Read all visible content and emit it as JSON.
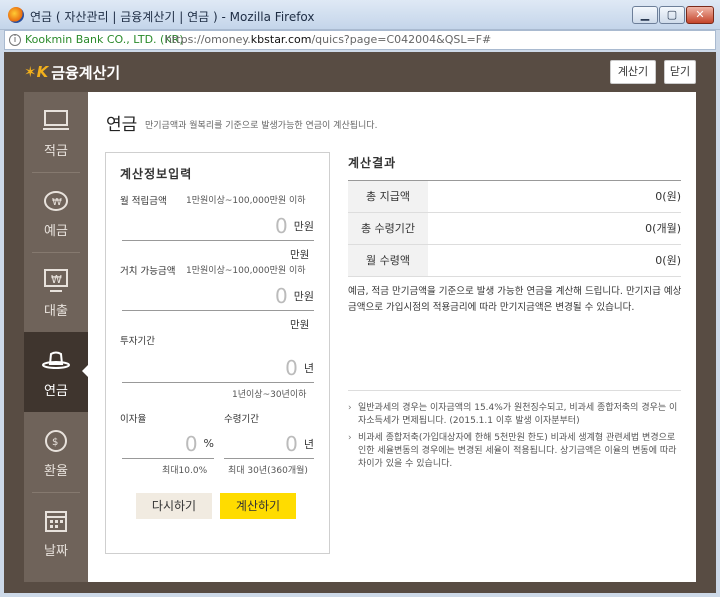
{
  "window": {
    "title": "연금 ( 자산관리 | 금융계산기 | 연금 ) - Mozilla Firefox",
    "minimize_icon": "▁",
    "maximize_icon": "▢",
    "close_icon": "✕"
  },
  "urlbar": {
    "info_icon": "i",
    "org": "Kookmin Bank CO., LTD. (KR)",
    "url_prefix": "https://omoney.",
    "url_domain": "kbstar.com",
    "url_suffix": "/quics?page=C042004&QSL=F#"
  },
  "app": {
    "logo_mark": "✶K",
    "logo_name": "금융계산기",
    "calc_button": "계산기",
    "close_button": "닫기"
  },
  "sidebar": {
    "items": [
      {
        "label": "적금",
        "icon": "savings-icon",
        "active": false
      },
      {
        "label": "예금",
        "icon": "piggybank-icon",
        "active": false
      },
      {
        "label": "대출",
        "icon": "loan-icon",
        "active": false
      },
      {
        "label": "연금",
        "icon": "hat-icon",
        "active": true
      },
      {
        "label": "환율",
        "icon": "exchange-icon",
        "active": false
      },
      {
        "label": "날짜",
        "icon": "calendar-icon",
        "active": false
      }
    ]
  },
  "page": {
    "title": "연금",
    "desc": "만기금액과 월복리를 기준으로 발생가능한 연금이 계산됩니다."
  },
  "form": {
    "title": "계산정보입력",
    "monthly": {
      "label": "월 적립금액",
      "range": "1만원이상~100,000만원 이하",
      "value": "0",
      "unit": "만원",
      "below": "만원"
    },
    "lump": {
      "label": "거치 가능금액",
      "range": "1만원이상~100,000만원 이하",
      "value": "0",
      "unit": "만원",
      "below": "만원"
    },
    "period": {
      "label": "투자기간",
      "value": "0",
      "unit": "년",
      "hint": "1년이상~30년이하"
    },
    "rate": {
      "label": "이자율",
      "value": "0",
      "unit": "%",
      "hint": "최대10.0%"
    },
    "receive": {
      "label": "수령기간",
      "value": "0",
      "unit": "년",
      "hint": "최대 30년(360개월)"
    },
    "reset_button": "다시하기",
    "calc_button": "계산하기"
  },
  "result": {
    "title": "계산결과",
    "rows": [
      {
        "key": "총 지급액",
        "value": "0(원)"
      },
      {
        "key": "총 수령기간",
        "value": "0(개월)"
      },
      {
        "key": "월 수령액",
        "value": "0(원)"
      }
    ],
    "note": "예금, 적금 만기금액을 기준으로 발생 가능한 연금을 계산해 드립니다. 만기지급 예상금액으로 가입시점의 적용금리에 따라 만기지금액은 변경될 수 있습니다.",
    "notes": [
      "일반과세의 경우는 이자금액의 15.4%가 원천징수되고, 비과세 종합저축의 경우는 이자소득세가 면제됩니다. (2015.1.1 이후 발생 이자분부터)",
      "비과세 종합저축(가입대상자에 한해 5천만원 한도) 비과세 생계형 관련세법 변경으로 인한 세율변동의 경우에는 변경된 세율이 적용됩니다. 상기금액은 이율의 변동에 따라 차이가 있을 수 있습니다."
    ]
  }
}
